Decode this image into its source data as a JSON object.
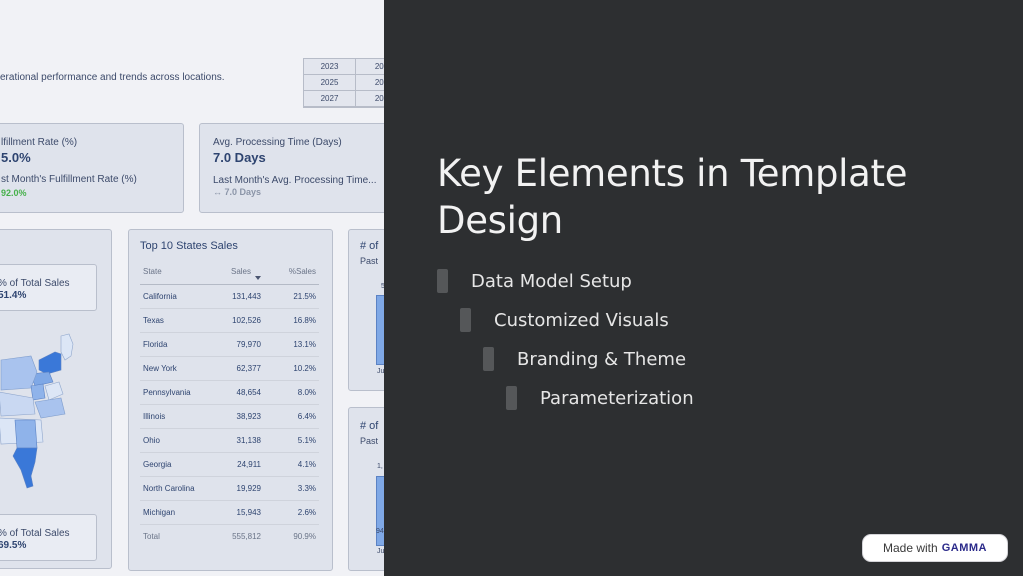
{
  "dashboard": {
    "subtitle": "erational performance and trends across locations.",
    "year_grid": [
      "2023",
      "202",
      "2025",
      "202",
      "2027",
      "202"
    ],
    "kpi_fulfillment": {
      "label": "lfillment Rate (%)",
      "value": "5.0%",
      "sub_label": "st Month's Fulfillment Rate (%)",
      "sub_value": "92.0%"
    },
    "kpi_processing": {
      "label": "Avg. Processing Time (Days)",
      "value": "7.0 Days",
      "sub_label": "Last Month's Avg. Processing Time...",
      "sub_value": "↔ 7.0 Days"
    },
    "map_card": {
      "top_label": "% of Total Sales",
      "top_value": "51.4%",
      "bottom_label": "% of Total Sales",
      "bottom_value": "69.5%"
    },
    "states_table": {
      "title": "Top 10 States Sales",
      "columns": [
        "State",
        "Sales",
        "%Sales"
      ],
      "rows": [
        [
          "California",
          "131,443",
          "21.5%"
        ],
        [
          "Texas",
          "102,526",
          "16.8%"
        ],
        [
          "Florida",
          "79,970",
          "13.1%"
        ],
        [
          "New York",
          "62,377",
          "10.2%"
        ],
        [
          "Pennsylvania",
          "48,654",
          "8.0%"
        ],
        [
          "Illinois",
          "38,923",
          "6.4%"
        ],
        [
          "Ohio",
          "31,138",
          "5.1%"
        ],
        [
          "Georgia",
          "24,911",
          "4.1%"
        ],
        [
          "North Carolina",
          "19,929",
          "3.3%"
        ],
        [
          "Michigan",
          "15,943",
          "2.6%"
        ]
      ],
      "total": [
        "Total",
        "555,812",
        "90.9%"
      ]
    },
    "side_card_top": {
      "title": "# of",
      "sub": "Past",
      "tick_top": "5",
      "tick_bottom": "Ju"
    },
    "side_card_bottom": {
      "title": "# of",
      "sub": "Past",
      "tick_top": "1,",
      "tick_mid": "94",
      "tick_bottom": "Ju"
    }
  },
  "slide": {
    "title": "Key Elements in Template Design",
    "bullets": [
      "Data Model Setup",
      "Customized Visuals",
      "Branding & Theme",
      "Parameterization"
    ]
  },
  "badge": {
    "prefix": "Made with",
    "brand": "GAMMA"
  },
  "colors": {
    "slide_bg": "#2d2f31",
    "dashboard_bg": "#f1f2f6",
    "card_bg": "#dfe3ec",
    "accent_blue": "#2e4470",
    "good_green": "#46b04a",
    "map_dark": "#3a78d8",
    "map_light": "#c9d8f2"
  }
}
